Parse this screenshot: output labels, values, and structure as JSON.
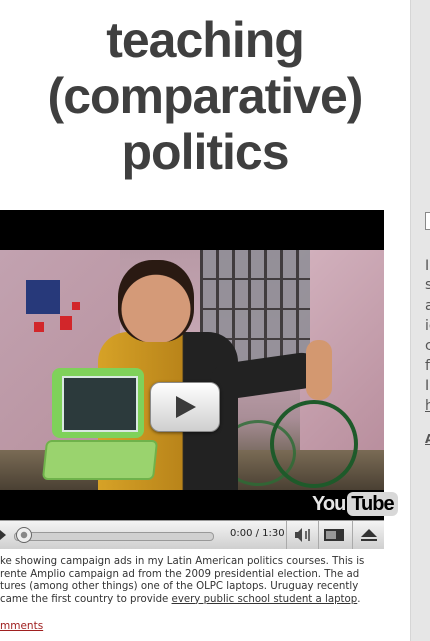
{
  "blog": {
    "title_line1": "teaching",
    "title_line2": "(comparative)",
    "title_line3": "politics"
  },
  "video": {
    "logo_you": "You",
    "logo_tube": "Tube",
    "time": "0:00 / 1:30",
    "progress": 0
  },
  "post": {
    "line1": "ke showing campaign ads in my Latin American politics courses. This is",
    "line2": "rente Amplio campaign ad from the 2009 presidential election. The ad",
    "line3": "tures (among other things) one of the OLPC laptops. Uruguay recently",
    "line4_prefix": "came the first country to provide ",
    "line4_link": "every public school student a laptop",
    "line4_suffix": ".",
    "comments_link": "mments"
  },
  "sidebar": {
    "letters": [
      "I",
      "s",
      "a",
      "ic",
      "c",
      "f",
      "I",
      "h"
    ],
    "bottom_link": "A"
  }
}
